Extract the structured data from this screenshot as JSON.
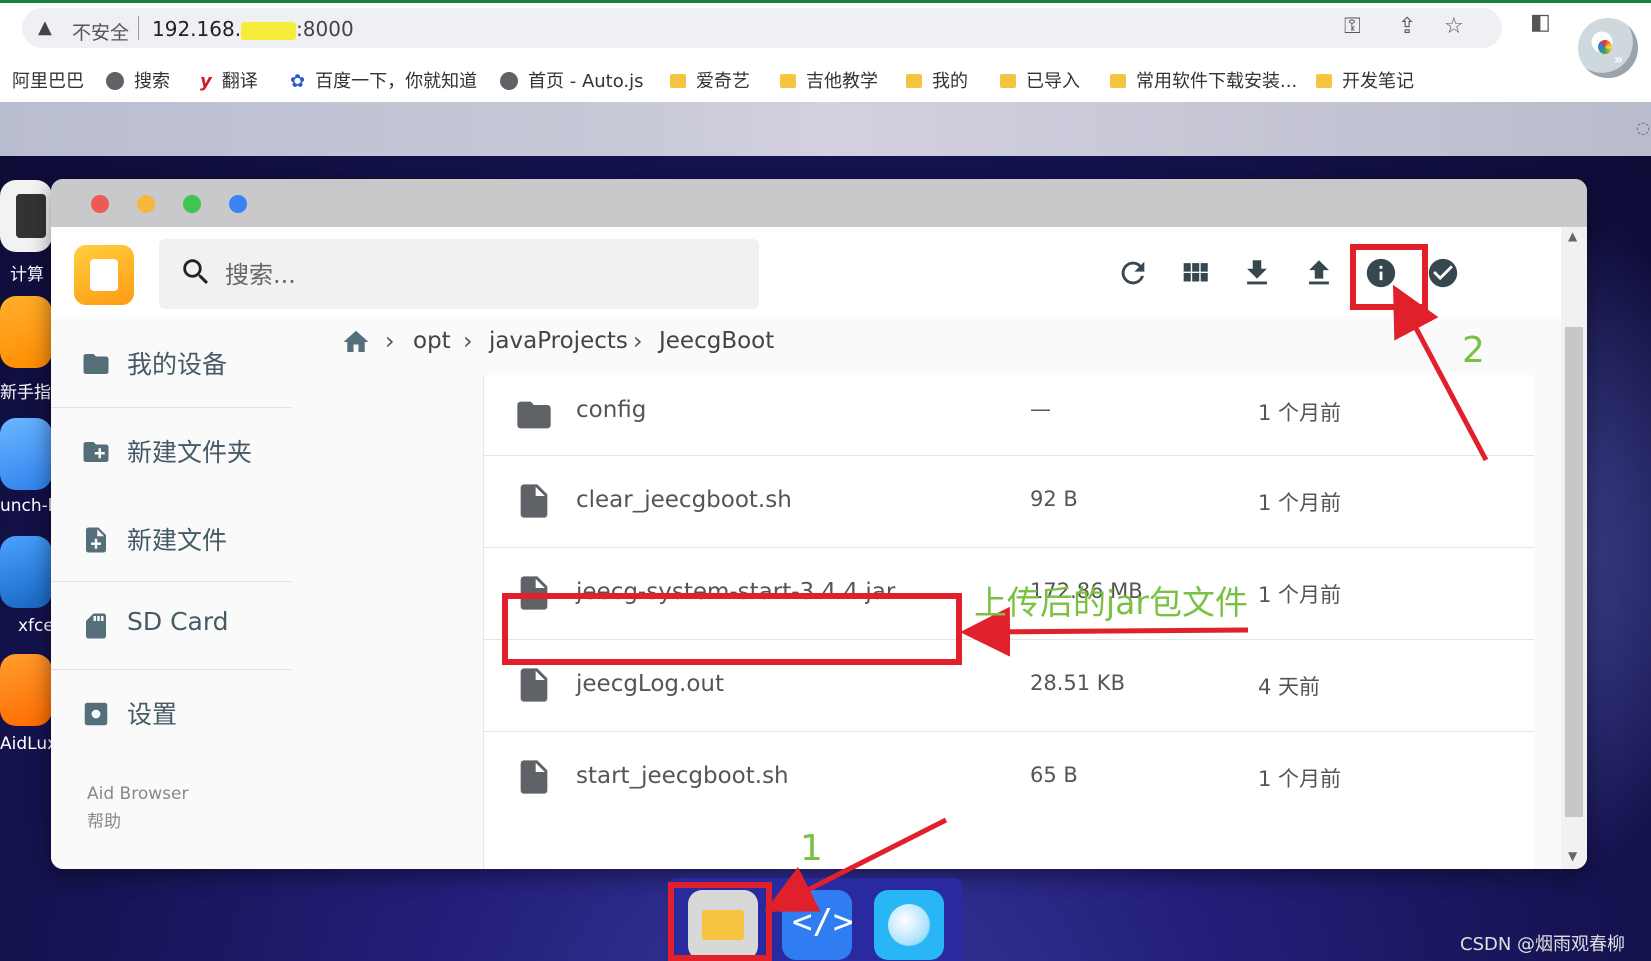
{
  "browser": {
    "security_label": "不安全",
    "url_host": "192.168.",
    "url_port": ":8000",
    "bookmarks": [
      "阿里巴巴",
      "搜索",
      "翻译",
      "百度一下，你就知道",
      "首页 - Auto.js",
      "爱奇艺",
      "吉他教学",
      "我的",
      "已导入",
      "常用软件下载安装...",
      "开发笔记"
    ],
    "bookmark_y_glyph": "y"
  },
  "desktop": {
    "icons": [
      "计算",
      "新手指",
      "unch-l",
      "xfce",
      "AidLux"
    ]
  },
  "file_manager": {
    "search_placeholder": "搜索...",
    "toolbar_buttons": [
      "refresh-icon",
      "grid-view-icon",
      "download-icon",
      "upload-icon",
      "info-icon",
      "select-all-icon"
    ],
    "sidebar": {
      "items": [
        "我的设备",
        "新建文件夹",
        "新建文件",
        "SD Card",
        "设置"
      ],
      "footer": [
        "Aid Browser",
        "帮助"
      ]
    },
    "breadcrumb": [
      "opt",
      "javaProjects",
      "JeecgBoot"
    ],
    "files": [
      {
        "name": "config",
        "size": "—",
        "modified": "1 个月前",
        "type": "folder"
      },
      {
        "name": "clear_jeecgboot.sh",
        "size": "92 B",
        "modified": "1 个月前",
        "type": "file"
      },
      {
        "name": "jeecg-system-start-3.4.4.jar",
        "size": "172.86 MB",
        "modified": "1 个月前",
        "type": "file"
      },
      {
        "name": "jeecgLog.out",
        "size": "28.51 KB",
        "modified": "4 天前",
        "type": "file"
      },
      {
        "name": "start_jeecgboot.sh",
        "size": "65 B",
        "modified": "1 个月前",
        "type": "file"
      }
    ]
  },
  "annotations": {
    "step1": "1",
    "step2": "2",
    "uploaded_note": "上传后的jar包文件",
    "accent_color": "#e0202a",
    "label_color": "#7ac143"
  },
  "watermark": "CSDN @烟雨观春柳"
}
